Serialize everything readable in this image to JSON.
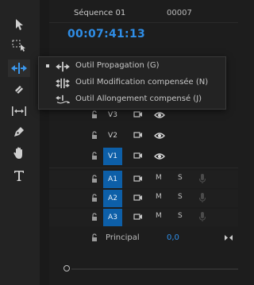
{
  "sequence": {
    "name": "Séquence 01",
    "frame_counter": "00007",
    "timecode": "00:07:41:13"
  },
  "toolbar": {
    "tools": [
      {
        "name": "Outil Sélection",
        "icon": "selection-arrow-icon"
      },
      {
        "name": "Outil Sélection de piste",
        "icon": "track-select-icon"
      },
      {
        "name": "Outil Propagation",
        "icon": "ripple-edit-icon",
        "active": true
      },
      {
        "name": "Outil Cutter",
        "icon": "razor-icon"
      },
      {
        "name": "Outil Déplacement",
        "icon": "slip-icon"
      },
      {
        "name": "Outil Plume",
        "icon": "pen-icon"
      },
      {
        "name": "Outil Main",
        "icon": "hand-icon"
      },
      {
        "name": "Outil Texte",
        "icon": "type-icon"
      }
    ]
  },
  "flyout": {
    "items": [
      {
        "label": "Outil Propagation (G)",
        "icon": "ripple-edit-icon",
        "selected": true
      },
      {
        "label": "Outil Modification compensée (N)",
        "icon": "rolling-edit-icon",
        "selected": false
      },
      {
        "label": "Outil Allongement compensé (J)",
        "icon": "rate-stretch-icon",
        "selected": false
      }
    ]
  },
  "tracks": {
    "video": [
      {
        "label": "V3",
        "selected": false
      },
      {
        "label": "V2",
        "selected": false
      },
      {
        "label": "V1",
        "selected": true
      }
    ],
    "audio": [
      {
        "label": "A1",
        "mute": "M",
        "solo": "S",
        "selected": true
      },
      {
        "label": "A2",
        "mute": "M",
        "solo": "S",
        "selected": true
      },
      {
        "label": "A3",
        "mute": "M",
        "solo": "S",
        "selected": true
      }
    ]
  },
  "master": {
    "label": "Principal",
    "value": "0,0"
  },
  "colors": {
    "accent": "#2f8ee7",
    "track_selected": "#0d5fa8"
  }
}
